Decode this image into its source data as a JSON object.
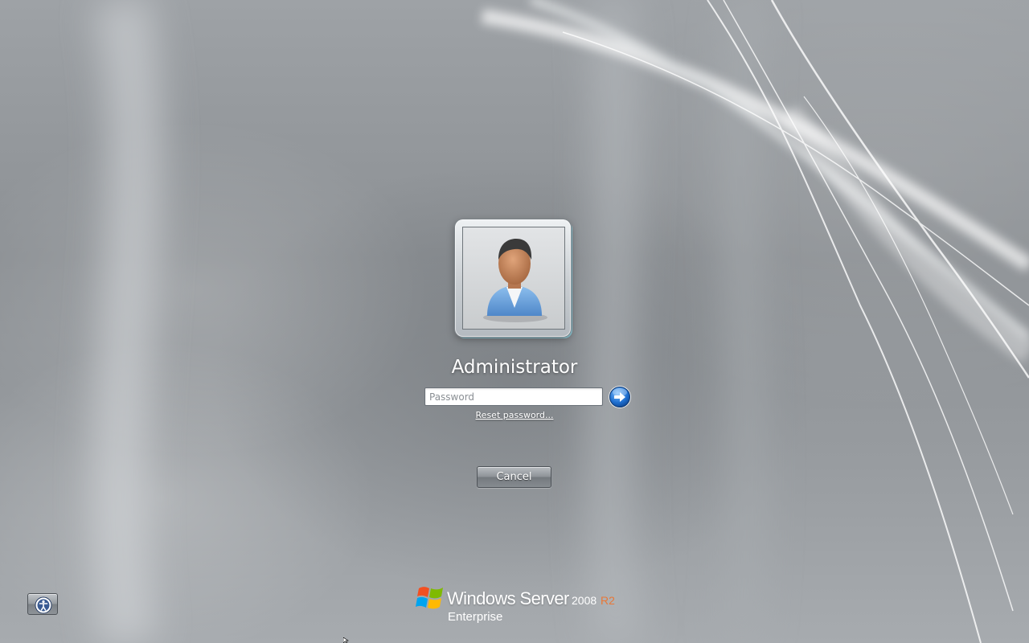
{
  "account": {
    "username": "Administrator",
    "avatar_icon": "user-avatar-icon"
  },
  "password": {
    "placeholder": "Password",
    "value": "",
    "submit_icon": "arrow-right-icon"
  },
  "links": {
    "reset_password": "Reset password..."
  },
  "buttons": {
    "cancel": "Cancel",
    "ease_of_access_icon": "ease-of-access-icon"
  },
  "branding": {
    "product": "Windows Server",
    "version": "2008",
    "release": "R2",
    "edition": "Enterprise",
    "logo_icon": "windows-flag-icon"
  },
  "colors": {
    "background": "#8c9094",
    "accent_orange": "#e87838",
    "submit_blue": "#1f6fd0"
  }
}
